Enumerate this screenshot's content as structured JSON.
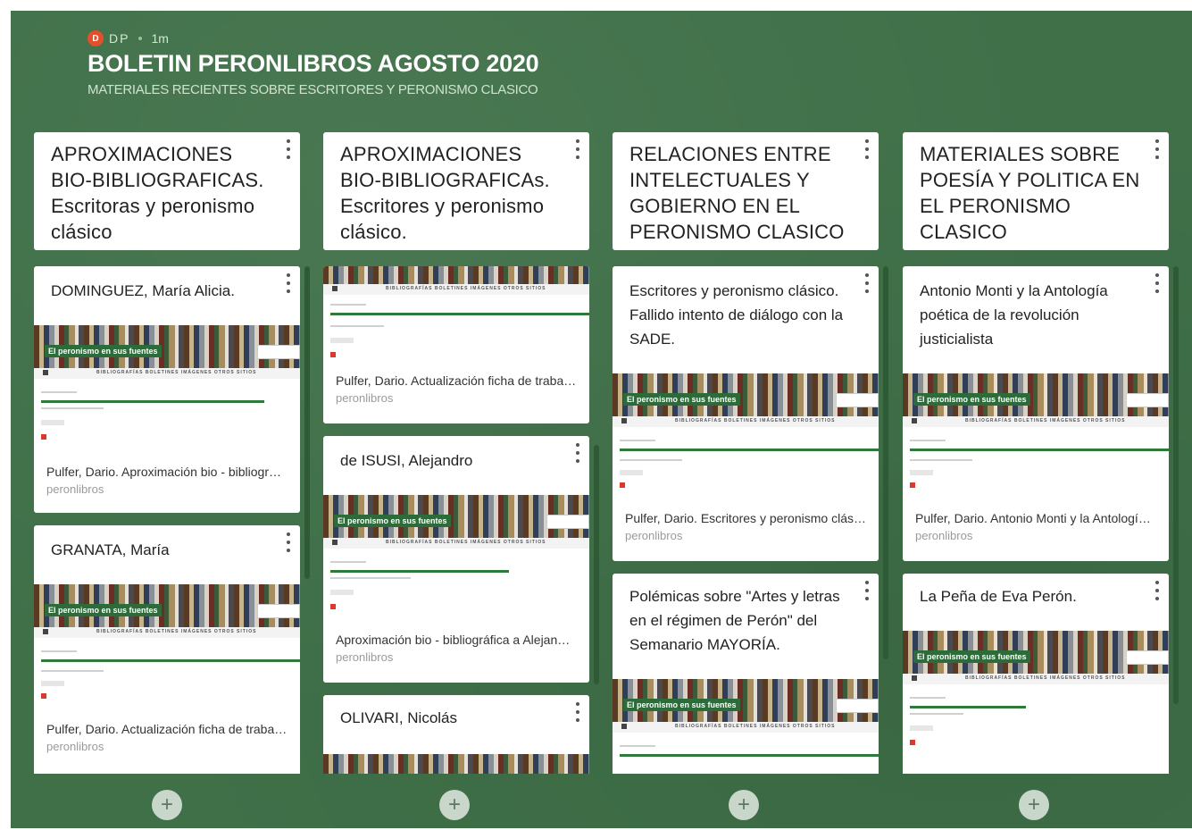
{
  "header": {
    "avatar_initial": "D",
    "author": "DP",
    "time": "1m",
    "title": "BOLETIN PERONLIBROS AGOSTO 2020",
    "subtitle": "MATERIALES RECIENTES SOBRE ESCRITORES Y PERONISMO CLASICO"
  },
  "thumbnail": {
    "badge": "El peronismo en sus fuentes",
    "nav": "BIBLIOGRAFÍAS   BOLETINES   IMÁGENES   OTROS SITIOS"
  },
  "add_label": "+",
  "colors": {
    "board": "#3f7048",
    "accent_green": "#2e6b3a",
    "pdf_red": "#d83b2b",
    "avatar": "#e4502b"
  },
  "columns": [
    {
      "title": "APROXIMACIONES BIO-BIBLIOGRAFICAS. Escritoras y peronismo clásico",
      "cards": [
        {
          "title": "DOMINGUEZ, María Alicia.",
          "caption": "Pulfer, Dario. Aproximación bio - bibliográfica a María A. Domínguez",
          "source": "peronlibros"
        },
        {
          "title": "GRANATA, María",
          "caption": "Pulfer, Dario. Actualización ficha de trabajo aproximación bio - bibliográfica",
          "source": "peronlibros"
        }
      ]
    },
    {
      "title": "APROXIMACIONES BIO-BIBLIOGRAFICAs. Escritores y peronismo clásico.",
      "cards": [
        {
          "title": "",
          "caption": "Pulfer, Dario. Actualización ficha de trabajo aproximación bio - bibliográfica",
          "source": "peronlibros"
        },
        {
          "title": "de ISUSI, Alejandro",
          "caption": "Aproximación bio - bibliográfica a Alejandro de Isusi",
          "source": "peronlibros"
        },
        {
          "title": "OLIVARI, Nicolás",
          "caption": "",
          "source": ""
        }
      ]
    },
    {
      "title": "RELACIONES ENTRE INTELECTUALES  Y GOBIERNO EN EL PERONISMO CLASICO",
      "cards": [
        {
          "title": "Escritores y peronismo clásico. Fallido intento de diálogo con la SADE.",
          "caption": "Pulfer, Dario. Escritores y peronismo clásico. Fallido intento de diálogo",
          "source": "peronlibros"
        },
        {
          "title": "Polémicas sobre \"Artes y letras en el régimen de Perón\" del Semanario MAYORÍA.",
          "caption": "",
          "source": ""
        }
      ]
    },
    {
      "title": "MATERIALES SOBRE POESÍA Y POLITICA EN EL PERONISMO CLASICO",
      "cards": [
        {
          "title": "Antonio Monti y la Antología poética de la revolución justicialista",
          "caption": "Pulfer, Dario. Antonio Monti y la Antología poética",
          "source": "peronlibros"
        },
        {
          "title": "La Peña de Eva Perón.",
          "caption": "",
          "source": ""
        }
      ]
    }
  ]
}
